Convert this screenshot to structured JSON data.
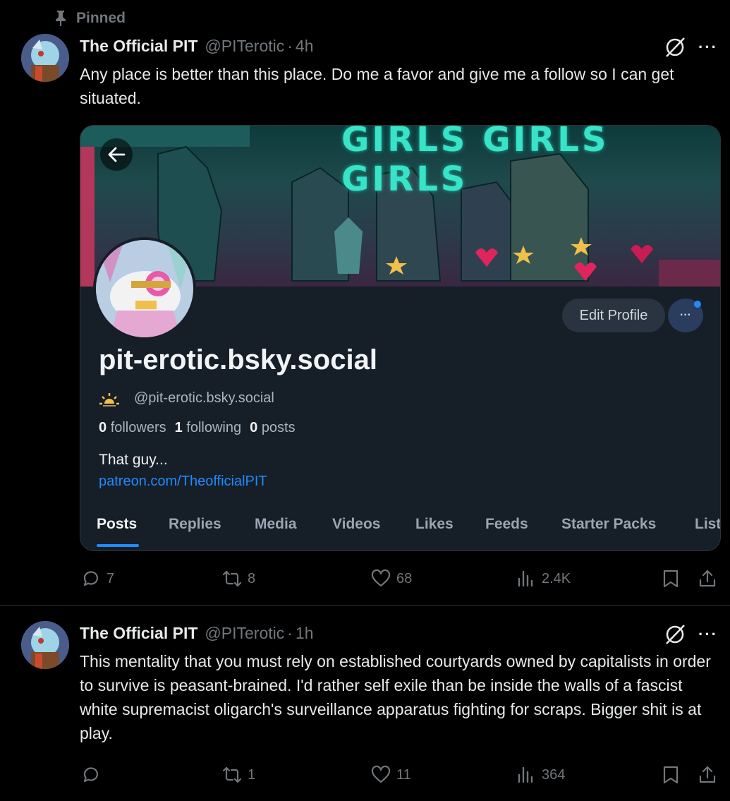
{
  "pinned_label": "Pinned",
  "posts": [
    {
      "name": "The Official PIT",
      "handle": "@PITerotic",
      "dot": "·",
      "time": "4h",
      "text": "Any place is better than this place. Do me a favor and give me a follow so I can get situated.",
      "more": "···",
      "replies": "7",
      "reposts": "8",
      "likes": "68",
      "views": "2.4K"
    },
    {
      "name": "The Official PIT",
      "handle": "@PITerotic",
      "dot": "·",
      "time": "1h",
      "text": "This mentality that you must rely on established courtyards owned by capitalists in order to survive is peasant-brained. I'd rather self exile than be inside the walls of a fascist white supremacist oligarch's surveillance apparatus fighting for scraps. Bigger shit is at play.",
      "more": "···",
      "replies": "",
      "reposts": "1",
      "likes": "11",
      "views": "364"
    }
  ],
  "embed": {
    "banner_text": "GIRLS GIRLS GIRLS",
    "edit_profile": "Edit Profile",
    "more": "···",
    "display_name": "pit-erotic.bsky.social",
    "handle": "@pit-erotic.bsky.social",
    "followers_count": "0",
    "followers_label": "followers",
    "following_count": "1",
    "following_label": "following",
    "posts_count": "0",
    "posts_label": "posts",
    "bio": "That guy...",
    "link": "patreon.com/TheofficialPIT",
    "tabs": [
      "Posts",
      "Replies",
      "Media",
      "Videos",
      "Likes",
      "Feeds",
      "Starter Packs",
      "List"
    ]
  },
  "colors": {
    "background": "#000000",
    "muted": "#71767b",
    "accent": "#208bfe",
    "card_bg": "#161e27"
  }
}
